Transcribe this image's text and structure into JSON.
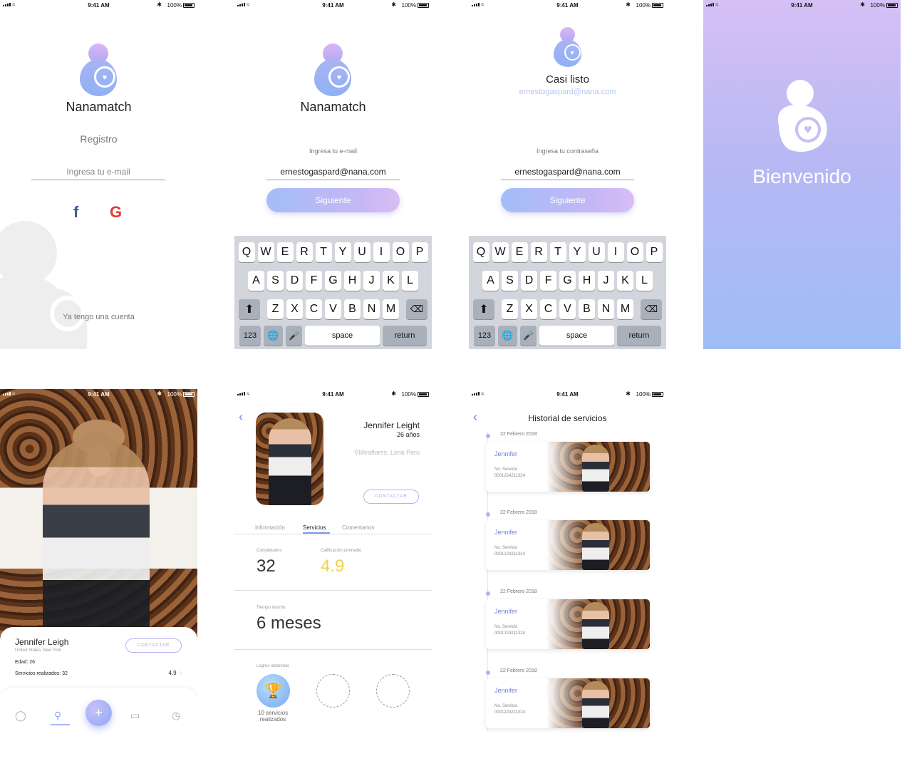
{
  "status": {
    "time": "9:41 AM",
    "battery": "100%"
  },
  "screen1": {
    "app_name": "Nanamatch",
    "title": "Registro",
    "email_placeholder": "Ingresa tu e-mail",
    "facebook_icon": "f",
    "google_icon": "G",
    "have_account": "Ya tengo una cuenta"
  },
  "screen2": {
    "app_name": "Nanamatch",
    "email_label": "Ingresa tu e-mail",
    "email_value": "ernestogaspard@nana.com",
    "next_button": "Siguiente"
  },
  "screen3": {
    "title": "Casi listo",
    "email_shown": "ernestogaspard@nana.com",
    "password_label": "Ingresa tu contraseña",
    "password_value": "ernestogaspard@nana.com",
    "next_button": "Siguiente"
  },
  "keyboard": {
    "row1": [
      "Q",
      "W",
      "E",
      "R",
      "T",
      "Y",
      "U",
      "I",
      "O",
      "P"
    ],
    "row2": [
      "A",
      "S",
      "D",
      "F",
      "G",
      "H",
      "J",
      "K",
      "L"
    ],
    "row3": [
      "Z",
      "X",
      "C",
      "V",
      "B",
      "N",
      "M"
    ],
    "numbers": "123",
    "space": "space",
    "return": "return"
  },
  "screen4": {
    "welcome": "Bienvenido"
  },
  "screen5": {
    "name": "Jennifer Leigh",
    "location": "United States, New York",
    "age": "Edad: 26",
    "services_done": "Servicios realizados: 32",
    "rating": "4.9",
    "contact_button": "CONTACTAR",
    "fab_icon": "+"
  },
  "screen6": {
    "name": "Jennifer Leight",
    "age": "26 años",
    "location": "Miraflores, Lima Peru",
    "contact_button": "CONTACTAR",
    "tabs": [
      "Información",
      "Servicios",
      "Comentarios"
    ],
    "completed_label": "Completados",
    "completed_value": "32",
    "avg_rating_label": "Calificación promedio",
    "avg_rating_value": "4.9",
    "time_label": "Tiempo inscrito",
    "time_value": "6 meses",
    "achievements_label": "Logros obtenidos",
    "achievement_1_line1": "10 servicios",
    "achievement_1_line2": "realizados"
  },
  "screen7": {
    "title": "Historial de servicios",
    "items": [
      {
        "date": "22 Febrero 2018",
        "name": "Jennifer",
        "service_label": "No. Servicio",
        "service_no": "0001224211324"
      },
      {
        "date": "22 Febrero 2018",
        "name": "Jennifer",
        "service_label": "No. Servicio",
        "service_no": "0001224211324"
      },
      {
        "date": "22 Febrero 2018",
        "name": "Jennifer",
        "service_label": "No. Servicio",
        "service_no": "0001224211324"
      },
      {
        "date": "22 Febrero 2018",
        "name": "Jennifer",
        "service_label": "No. Servicio",
        "service_no": "0001224211324"
      }
    ]
  },
  "colors": {
    "accent": "#8fa6f5",
    "gradient_start": "#d6c0f5",
    "gradient_end": "#9fbcf6",
    "rating_yellow": "#f0d04a",
    "facebook": "#3b5998",
    "google": "#e53935"
  }
}
